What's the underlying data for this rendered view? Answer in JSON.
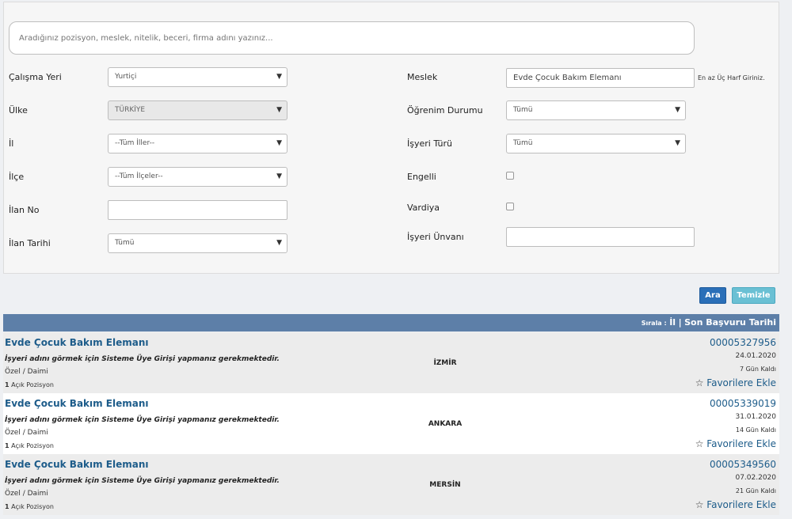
{
  "search": {
    "placeholder": "Aradığınız pozisyon, meslek, nitelik, beceri, firma adını yazınız..."
  },
  "filters": {
    "calisma_yeri": {
      "label": "Çalışma Yeri",
      "value": "Yurtiçi"
    },
    "ulke": {
      "label": "Ülke",
      "value": "TÜRKİYE"
    },
    "il": {
      "label": "İl",
      "value": "--Tüm İller--"
    },
    "ilce": {
      "label": "İlçe",
      "value": "--Tüm İlçeler--"
    },
    "ilan_no": {
      "label": "İlan No",
      "value": ""
    },
    "ilan_tarihi": {
      "label": "İlan Tarihi",
      "value": "Tümü"
    },
    "meslek": {
      "label": "Meslek",
      "value": "Evde Çocuk Bakım Elemanı",
      "hint": "En az Üç Harf Giriniz."
    },
    "ogrenim_durumu": {
      "label": "Öğrenim Durumu",
      "value": "Tümü"
    },
    "isyeri_turu": {
      "label": "İşyeri Türü",
      "value": "Tümü"
    },
    "engelli": {
      "label": "Engelli",
      "checked": false
    },
    "vardiya": {
      "label": "Vardiya",
      "checked": false
    },
    "isyeri_unvani": {
      "label": "İşyeri Ünvanı",
      "value": ""
    }
  },
  "buttons": {
    "ara": "Ara",
    "temizle": "Temizle"
  },
  "sort": {
    "label": "Sırala :",
    "il": "İl",
    "separator": "|",
    "son_basvuru": "Son Başvuru Tarihi"
  },
  "listings": [
    {
      "title": "Evde Çocuk Bakım Elemanı",
      "note": "İşyeri adını görmek için Sisteme Üye Girişi yapmanız gerekmektedir.",
      "type": "Özel / Daimi",
      "positions_count": "1",
      "positions_label": "Açık Pozisyon",
      "city": "İZMİR",
      "ilan_no": "00005327956",
      "date": "24.01.2020",
      "days_left": "7 Gün Kaldı",
      "fav": "Favorilere Ekle"
    },
    {
      "title": "Evde Çocuk Bakım Elemanı",
      "note": "İşyeri adını görmek için Sisteme Üye Girişi yapmanız gerekmektedir.",
      "type": "Özel / Daimi",
      "positions_count": "1",
      "positions_label": "Açık Pozisyon",
      "city": "ANKARA",
      "ilan_no": "00005339019",
      "date": "31.01.2020",
      "days_left": "14 Gün Kaldı",
      "fav": "Favorilere Ekle"
    },
    {
      "title": "Evde Çocuk Bakım Elemanı",
      "note": "İşyeri adını görmek için Sisteme Üye Girişi yapmanız gerekmektedir.",
      "type": "Özel / Daimi",
      "positions_count": "1",
      "positions_label": "Açık Pozisyon",
      "city": "MERSİN",
      "ilan_no": "00005349560",
      "date": "07.02.2020",
      "days_left": "21 Gün Kaldı",
      "fav": "Favorilere Ekle"
    }
  ],
  "icons": {
    "dropdown": "▼",
    "star": "☆"
  }
}
